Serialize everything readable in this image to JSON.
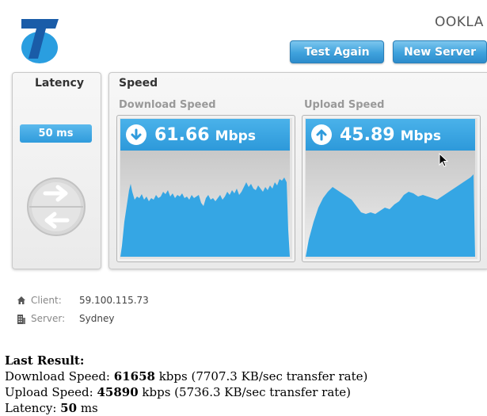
{
  "header": {
    "partner_logo_icon": "telstra-t-logo",
    "brand": "OOKLA",
    "test_again_label": "Test Again",
    "new_server_label": "New Server"
  },
  "latency": {
    "title": "Latency",
    "value": "50 ms",
    "icon": "exchange-arrows-icon"
  },
  "speed": {
    "title": "Speed",
    "download": {
      "label": "Download Speed",
      "value": "61.66",
      "unit": "Mbps",
      "icon": "arrow-down-icon"
    },
    "upload": {
      "label": "Upload Speed",
      "value": "45.89",
      "unit": "Mbps",
      "icon": "arrow-up-icon"
    }
  },
  "info": {
    "client_label": "Client:",
    "client_value": "59.100.115.73",
    "server_label": "Server:",
    "server_value": "Sydney"
  },
  "last_result": {
    "heading": "Last Result:",
    "download_prefix": "Download Speed: ",
    "download_kbps": "61658",
    "download_suffix": " kbps (7707.3 KB/sec transfer rate)",
    "upload_prefix": "Upload Speed: ",
    "upload_kbps": "45890",
    "upload_suffix": " kbps (5736.3 KB/sec transfer rate)",
    "latency_prefix": "Latency: ",
    "latency_value": "50",
    "latency_suffix": " ms"
  },
  "colors": {
    "accent": "#2f9bdc",
    "graph_fill": "#35a6e4",
    "panel_bg": "#eeeeee"
  }
}
